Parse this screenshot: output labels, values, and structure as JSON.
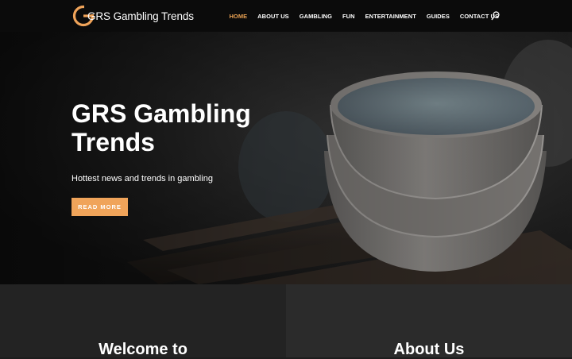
{
  "site": {
    "logo_text": "GRS Gambling Trends",
    "logo_color": "#f0a45a"
  },
  "nav": {
    "items": [
      {
        "label": "HOME",
        "active": true
      },
      {
        "label": "ABOUT US",
        "active": false
      },
      {
        "label": "GAMBLING",
        "active": false
      },
      {
        "label": "FUN",
        "active": false
      },
      {
        "label": "ENTERTAINMENT",
        "active": false
      },
      {
        "label": "GUIDES",
        "active": false
      },
      {
        "label": "CONTACT US",
        "active": false
      }
    ],
    "search_icon": "search-icon",
    "active_color": "#e9a152"
  },
  "hero": {
    "title": "GRS Gambling Trends",
    "subtitle": "Hottest news and trends in gambling",
    "button_label": "READ MORE",
    "button_color": "#f0a45a"
  },
  "sections": {
    "left_title": "Welcome to",
    "right_title": "About Us"
  }
}
